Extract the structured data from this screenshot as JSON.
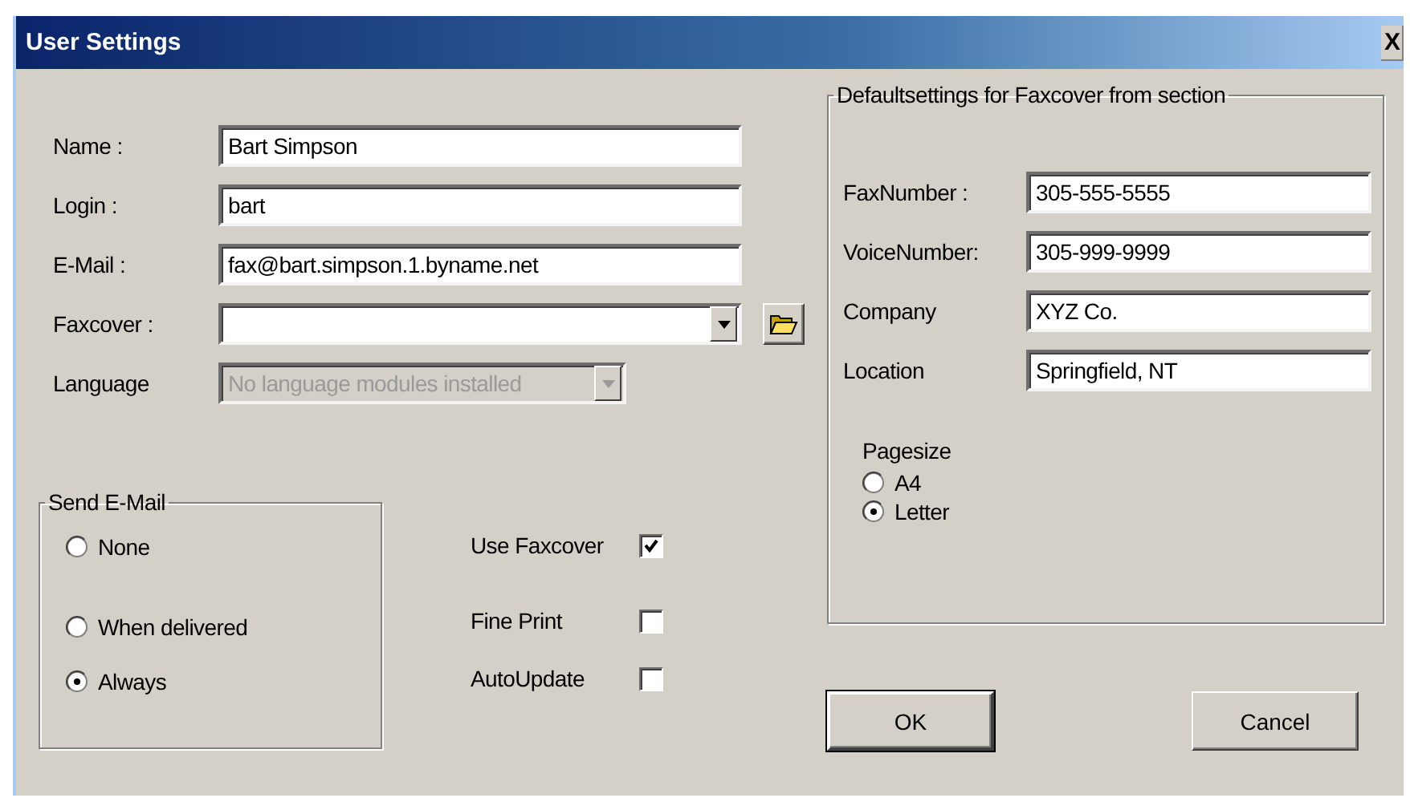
{
  "window": {
    "title": "User Settings",
    "close": "X"
  },
  "fields": [
    {
      "label": "Name :",
      "value": "Bart Simpson",
      "kind": "text",
      "disabled": false
    },
    {
      "label": "Login :",
      "value": "bart",
      "kind": "text",
      "disabled": false
    },
    {
      "label": "E-Mail :",
      "value": "fax@bart.simpson.1.byname.net",
      "kind": "text",
      "disabled": false
    },
    {
      "label": "Faxcover :",
      "kind": "combo-browse",
      "disabled": false
    },
    {
      "label": "Language",
      "value": "No language modules installed",
      "kind": "combo",
      "disabled": true
    }
  ],
  "send_email": {
    "title": "Send E-Mail",
    "options": [
      {
        "label": "None",
        "selected": false
      },
      {
        "label": "When delivered",
        "selected": false
      },
      {
        "label": "Always",
        "selected": true
      }
    ]
  },
  "options": [
    {
      "label": "Use Faxcover",
      "checked": true
    },
    {
      "label": "Fine Print",
      "checked": false
    },
    {
      "label": "AutoUpdate",
      "checked": false
    }
  ],
  "defaults": {
    "title": "Defaultsettings for Faxcover from section",
    "fields": [
      {
        "label": "FaxNumber :",
        "value": "305-555-5555"
      },
      {
        "label": "VoiceNumber:",
        "value": "305-999-9999"
      },
      {
        "label": "Company",
        "value": "XYZ Co."
      },
      {
        "label": "Location",
        "value": "Springfield, NT"
      }
    ],
    "pagesize": {
      "label": "Pagesize",
      "options": [
        {
          "label": "A4",
          "selected": false
        },
        {
          "label": "Letter",
          "selected": true
        }
      ]
    }
  },
  "buttons": [
    {
      "label": "OK",
      "default": true
    },
    {
      "label": "Cancel",
      "default": false
    }
  ]
}
